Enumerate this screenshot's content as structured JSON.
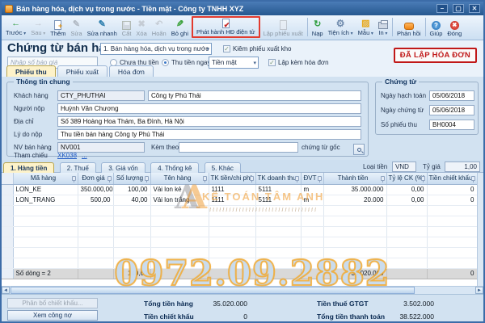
{
  "window": {
    "title": "Bán hàng hóa, dịch vụ trong nước - Tiền mặt - Công ty TNHH XYZ"
  },
  "toolbar": {
    "buttons": [
      {
        "label": "Trước",
        "icon": "arrow-left-icon",
        "enabled": true
      },
      {
        "label": "Sau",
        "icon": "arrow-right-icon",
        "enabled": false
      },
      {
        "label": "Thêm",
        "icon": "new-document-icon",
        "enabled": true
      },
      {
        "label": "Sửa",
        "icon": "edit-icon",
        "enabled": false
      },
      {
        "label": "Sửa nhanh",
        "icon": "quick-edit-icon",
        "enabled": true
      },
      {
        "label": "Cất",
        "icon": "save-floppy-icon",
        "enabled": false
      },
      {
        "label": "Xóa",
        "icon": "delete-icon",
        "enabled": false
      },
      {
        "label": "Hoãn",
        "icon": "undo-icon",
        "enabled": false
      },
      {
        "label": "Bỏ ghi",
        "icon": "unpost-icon",
        "enabled": true
      },
      {
        "label": "Phát hành HĐ điện tử",
        "icon": "invoice-check-icon",
        "enabled": true,
        "highlighted": true
      },
      {
        "label": "Lập phiếu xuất",
        "icon": "export-slip-icon",
        "enabled": false
      },
      {
        "label": "Nạp",
        "icon": "refresh-icon",
        "enabled": true
      },
      {
        "label": "Tiện ích",
        "icon": "utilities-icon",
        "enabled": true
      },
      {
        "label": "Mẫu",
        "icon": "template-icon",
        "enabled": true
      },
      {
        "label": "In",
        "icon": "printer-icon",
        "enabled": true
      },
      {
        "label": "Phản hồi",
        "icon": "feedback-icon",
        "enabled": true
      },
      {
        "label": "Giúp",
        "icon": "help-icon",
        "enabled": true
      },
      {
        "label": "Đóng",
        "icon": "close-icon",
        "enabled": true
      }
    ]
  },
  "header": {
    "title": "Chứng từ bán hàng",
    "doc_type": "1. Bán hàng hóa, dịch vụ trong nước",
    "kiem_phieu_xuat_kho": "Kiêm phiếu xuất kho",
    "quote_placeholder": "Nhập số báo giá",
    "radio_chua_thu_tien": "Chưa thu tiền",
    "radio_thu_tien_ngay": "Thu tiền ngay",
    "payment_method": "Tiền mặt",
    "lap_kem_hoa_don": "Lập kèm hóa đơn",
    "stamp": "ĐÃ LẬP HÓA ĐƠN",
    "tabs": [
      {
        "label": "Phiếu thu"
      },
      {
        "label": "Phiếu xuất"
      },
      {
        "label": "Hóa đơn"
      }
    ]
  },
  "general_info": {
    "legend": "Thông tin chung",
    "khach_hang_label": "Khách hàng",
    "khach_hang_code": "CTY_PHUTHAI",
    "khach_hang_name": "Công ty Phú Thái",
    "nguoi_nop_label": "Người nộp",
    "nguoi_nop": "Huỳnh Văn Chương",
    "dia_chi_label": "Địa chỉ",
    "dia_chi": "Số 389 Hoàng Hoa Thám, Ba Đình, Hà Nội",
    "ly_do_nop_label": "Lý do nộp",
    "ly_do_nop": "Thu tiền bán hàng Công ty Phú Thái",
    "nv_ban_hang_label": "NV bán hàng",
    "nv_ban_hang": "NV001",
    "kem_theo_label": "Kèm theo",
    "kem_theo": "",
    "kem_theo_suffix": "chứng từ gốc",
    "tham_chieu_label": "Tham chiếu",
    "tham_chieu_link": "XK038",
    "more_link": "..."
  },
  "document_info": {
    "legend": "Chứng từ",
    "ngay_hach_toan_label": "Ngày hạch toán",
    "ngay_hach_toan": "05/06/2018",
    "ngay_chung_tu_label": "Ngày chứng từ",
    "ngay_chung_tu": "05/06/2018",
    "so_phieu_thu_label": "Số phiếu thu",
    "so_phieu_thu": "BH0004"
  },
  "detail": {
    "tabs": [
      {
        "label": "1. Hàng tiền"
      },
      {
        "label": "2. Thuế"
      },
      {
        "label": "3. Giá vốn"
      },
      {
        "label": "4. Thống kê"
      },
      {
        "label": "5. Khác"
      }
    ],
    "currency_label": "Loại tiền",
    "currency": "VND",
    "rate_label": "Tỷ giá",
    "rate": "1,00"
  },
  "grid": {
    "columns": [
      "Mã hàng",
      "Đơn giá",
      "Số lượng",
      "Tên hàng",
      "TK tiền/chi phí",
      "TK doanh thu",
      "ĐVT",
      "Thành tiền",
      "Tỷ lệ CK (%)",
      "Tiền chiết khấu"
    ],
    "rows": [
      {
        "code": "LON_KE",
        "unit_price": "350.000,00",
        "qty": "100,00",
        "name": "Vải lon kẻ",
        "tk_tien": "1111",
        "tk_doanh_thu": "5111",
        "dvt": "m",
        "amount": "35.000.000",
        "ck_rate": "0,00",
        "ck_amount": "0"
      },
      {
        "code": "LON_TRANG",
        "unit_price": "500,00",
        "qty": "40,00",
        "name": "Vải lon trắng",
        "tk_tien": "1111",
        "tk_doanh_thu": "5111",
        "dvt": "m",
        "amount": "20.000",
        "ck_rate": "0,00",
        "ck_amount": "0"
      }
    ],
    "summary": {
      "count": "Số dòng = 2",
      "qty": "140,00",
      "amount": "35.020.000",
      "discount": "0"
    }
  },
  "footer": {
    "allocate_discount_btn": "Phân bổ chiết khấu...",
    "view_debt_btn": "Xem công nợ",
    "tong_tien_hang_label": "Tổng tiền hàng",
    "tong_tien_hang": "35.020.000",
    "tien_chiet_khau_label": "Tiền chiết khấu",
    "tien_chiet_khau": "0",
    "tien_thue_label": "Tiền thuế GTGT",
    "tien_thue": "3.502.000",
    "tong_thanh_toan_label": "Tổng tiền thanh toán",
    "tong_thanh_toan": "38.522.000"
  },
  "watermark": {
    "brand": "KẾ TOÁN TÂM ANH",
    "phone": "0972.09.2882"
  },
  "colors": {
    "titlebar_blue": "#2e5f9e",
    "stamp_red": "#c01818",
    "highlight_red": "#e23b2e",
    "active_tab_yellow": "#fdf2c9",
    "watermark_orange": "#f09f2e",
    "link_blue": "#1a56c4"
  }
}
